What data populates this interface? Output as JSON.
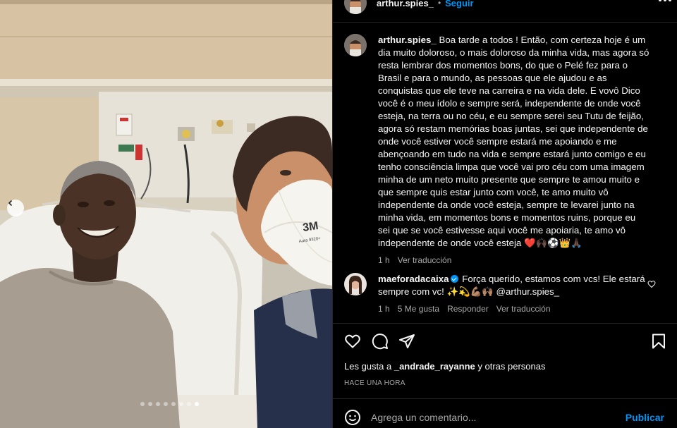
{
  "post": {
    "username": "arthur.spies_",
    "separator": "•",
    "follow_label": "Seguir",
    "more_icon": "more-horizontal-icon"
  },
  "carousel": {
    "prev_icon": "chevron-left-icon",
    "slide_count": 8,
    "active_slide": 8,
    "mask_print_brand": "3M",
    "mask_print_model": "Aura 9320+"
  },
  "caption": {
    "username": "arthur.spies_",
    "text": "Boa tarde a todos ! Então, com certeza hoje é um dia muito doloroso, o mais doloroso da minha vida, mas agora só resta lembrar dos momentos bons, do que o Pelé fez para o Brasil e para o mundo, as pessoas que ele ajudou e as conquistas que ele teve na carreira e na vida dele. E vovô Dico você é o meu ídolo e sempre será, independente de onde você esteja, na terra ou no céu, e eu sempre serei seu Tutu de feijão, agora só restam memórias boas juntas, sei que independente de onde você estiver você sempre estará me apoiando e me abençoando em tudo na vida e sempre estará junto comigo e eu tenho consciência limpa que você vai pro céu com uma imagem minha de um neto muito presente que sempre te amou muito e que sempre quis estar junto com você, te amo muito vô independente da onde você esteja, sempre te levarei junto na minha vida, em momentos bons e momentos ruins, porque eu sei que se você estivesse aqui você me apoiaria, te amo vô independente de onde você esteja ❤️🙌🏿⚽👑🙏🏿",
    "time": "1 h",
    "translate": "Ver traducción"
  },
  "comment": {
    "username": "maeforadacaixa",
    "text": "Força querido, estamos com vcs! Ele estará sempre com vc! ✨💫💪🏽🙌🏽 @arthur.spies_",
    "time": "1 h",
    "likes": "5 Me gusta",
    "reply": "Responder",
    "translate": "Ver traducción"
  },
  "actions": {
    "like_icon": "heart-icon",
    "comment_icon": "comment-icon",
    "share_icon": "send-icon",
    "save_icon": "bookmark-icon"
  },
  "likes": {
    "prefix": "Les gusta a",
    "user": "_andrade_rayanne",
    "suffix": "y otras personas"
  },
  "timestamp": "HACE UNA HORA",
  "composer": {
    "emoji_icon": "emoji-icon",
    "placeholder": "Agrega un comentario...",
    "publish_label": "Publicar"
  }
}
